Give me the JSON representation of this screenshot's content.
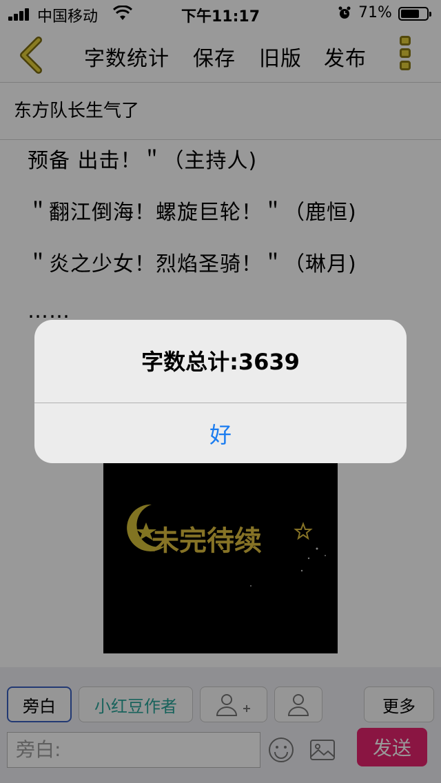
{
  "status_bar": {
    "carrier": "中国移动",
    "time": "下午11:17",
    "battery_percent": "71%",
    "battery_level": 0.71
  },
  "nav": {
    "back_icon": "chevron-left-icon",
    "items": [
      "字数统计",
      "保存",
      "旧版",
      "发布"
    ],
    "more_icon": "vertical-dots-icon",
    "accent_color": "#e4cf3a"
  },
  "document": {
    "title": "东方队长生气了",
    "lines": [
      "预备 出击！＂（主持人)",
      "＂翻江倒海！螺旋巨轮！＂（鹿恒)",
      "＂炎之少女！烈焰圣骑！＂（琳月)",
      "……"
    ],
    "image_caption": "未完待续"
  },
  "toolbar": {
    "roles": [
      "旁白",
      "小红豆作者"
    ],
    "more_label": "更多",
    "input_placeholder": "旁白:",
    "send_label": "发送",
    "send_color": "#e6246e"
  },
  "alert": {
    "message": "字数总计:3639",
    "ok_label": "好"
  }
}
